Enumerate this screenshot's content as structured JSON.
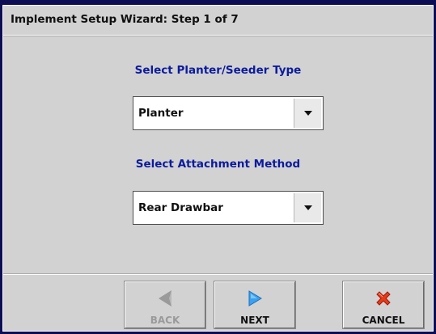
{
  "window": {
    "title": "Implement Setup Wizard:  Step 1 of 7"
  },
  "planter_type": {
    "label": "Select Planter/Seeder Type",
    "selected": "Planter"
  },
  "attachment": {
    "label": "Select Attachment Method",
    "selected": "Rear Drawbar"
  },
  "footer": {
    "back_label": "BACK",
    "back_enabled": false,
    "next_label": "NEXT",
    "cancel_label": "CANCEL"
  },
  "colors": {
    "background": "#0d0d55",
    "panel": "#d2d2d2",
    "label_text": "#0b1b9e",
    "next_arrow": "#3aa0f0",
    "cancel_x": "#e83a1a",
    "back_arrow_disabled": "#9a9a9a"
  },
  "icons": {
    "back": "left-triangle-icon",
    "next": "right-triangle-icon",
    "cancel": "red-x-icon",
    "dropdown": "chevron-down-icon"
  }
}
